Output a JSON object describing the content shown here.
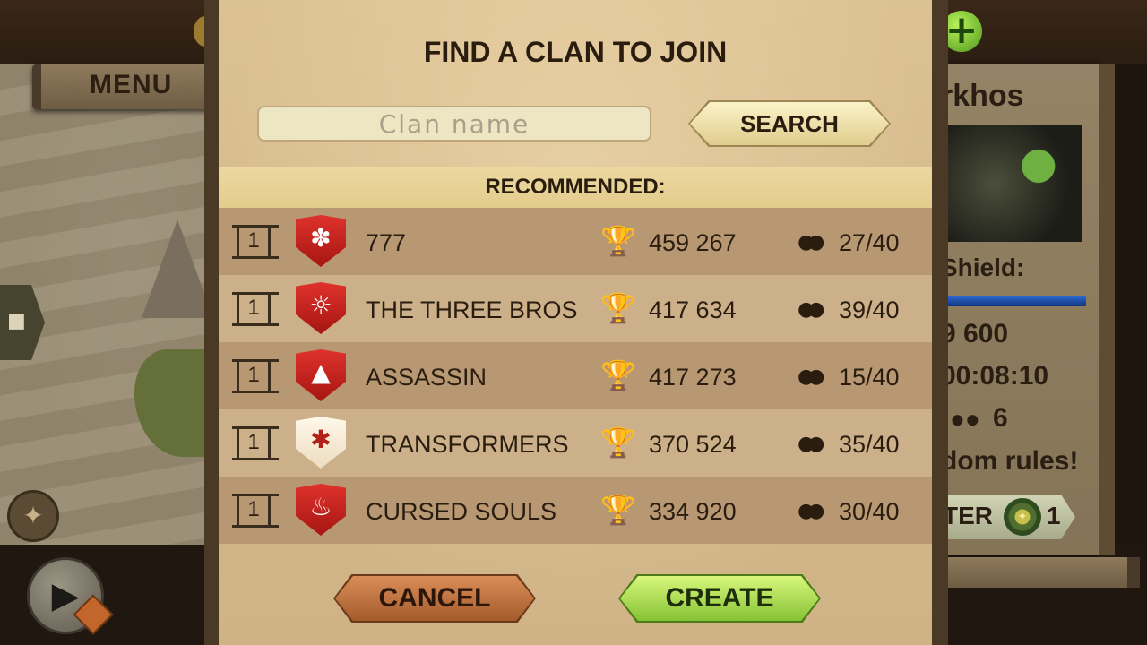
{
  "background": {
    "menu_label": "MENU",
    "right_panel": {
      "name_partial": "rkhos",
      "shield_label": "Shield:",
      "value_line": "9 600",
      "timer": "00:08:10",
      "members_count": "6",
      "motto_partial": "dom rules!",
      "button_partial": "TER",
      "button_count": "1"
    }
  },
  "dialog": {
    "title": "FIND A CLAN TO JOIN",
    "search": {
      "placeholder": "Clan name",
      "value": "",
      "button_label": "SEARCH"
    },
    "recommended_label": "RECOMMENDED:",
    "clans": [
      {
        "rank": "1",
        "crest": "paw-crest-icon",
        "crest_color": "red",
        "name": "777",
        "trophies": "459 267",
        "members": "27/40"
      },
      {
        "rank": "1",
        "crest": "samurai-mask-crest-icon",
        "crest_color": "red",
        "name": "THE THREE BROS",
        "trophies": "417 634",
        "members": "39/40"
      },
      {
        "rank": "1",
        "crest": "wolf-crest-icon",
        "crest_color": "red",
        "name": "ASSASSIN",
        "trophies": "417 273",
        "members": "15/40"
      },
      {
        "rank": "1",
        "crest": "spider-crest-icon",
        "crest_color": "white",
        "name": "TRANSFORMERS",
        "trophies": "370 524",
        "members": "35/40"
      },
      {
        "rank": "1",
        "crest": "flame-crest-icon",
        "crest_color": "red",
        "name": "CURSED SOULS",
        "trophies": "334 920",
        "members": "30/40"
      }
    ],
    "cancel_label": "CANCEL",
    "create_label": "CREATE"
  },
  "colors": {
    "parchment": "#d6bb8c",
    "row_dark": "#b79872",
    "row_light": "#cbb089",
    "crest_red": "#c8201a",
    "create_green": "#a8dc55",
    "cancel_orange": "#c2743f"
  }
}
